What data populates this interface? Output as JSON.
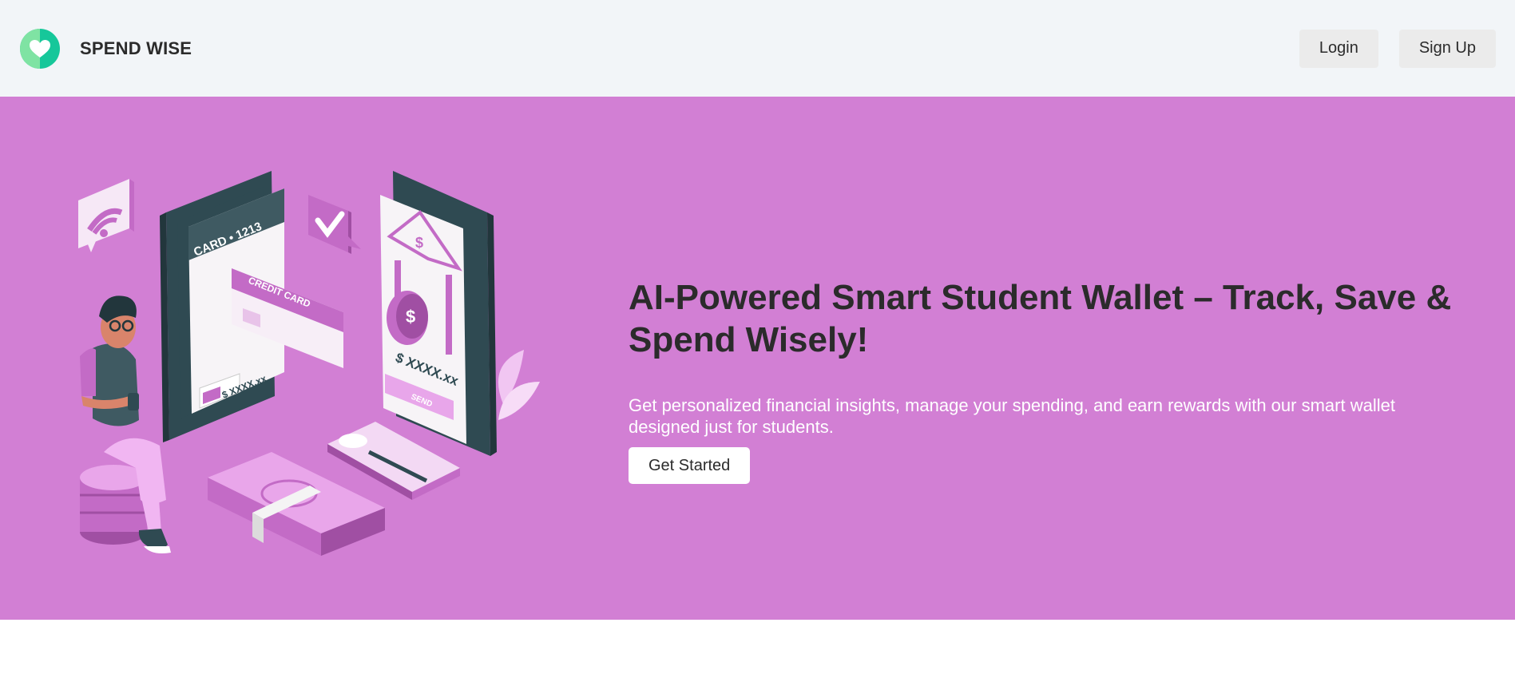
{
  "header": {
    "brand_name": "SPEND WISE",
    "login_label": "Login",
    "signup_label": "Sign Up"
  },
  "hero": {
    "title": "AI-Powered Smart Student Wallet – Track, Save & Spend Wisely!",
    "subtitle": "Get personalized financial insights, manage your spending, and earn rewards with our smart wallet designed just for students.",
    "cta_label": "Get Started",
    "background_color": "#d27fd4"
  },
  "illustration": {
    "card_label": "CARD • 1213",
    "credit_card_label": "CREDIT CARD",
    "amount_left": "$ XXXX.xx",
    "amount_right": "$ XXXX.xx",
    "send_label": "SEND",
    "bank_symbol": "$",
    "coin_symbol": "$"
  },
  "icons": {
    "logo": "heart-logo-icon",
    "wifi": "wifi-icon",
    "check": "checkmark-icon"
  },
  "colors": {
    "navbar_bg": "#f2f5f8",
    "accent": "#d27fd4",
    "logo_green": "#16c79a",
    "text_dark": "#2b2b2b"
  }
}
